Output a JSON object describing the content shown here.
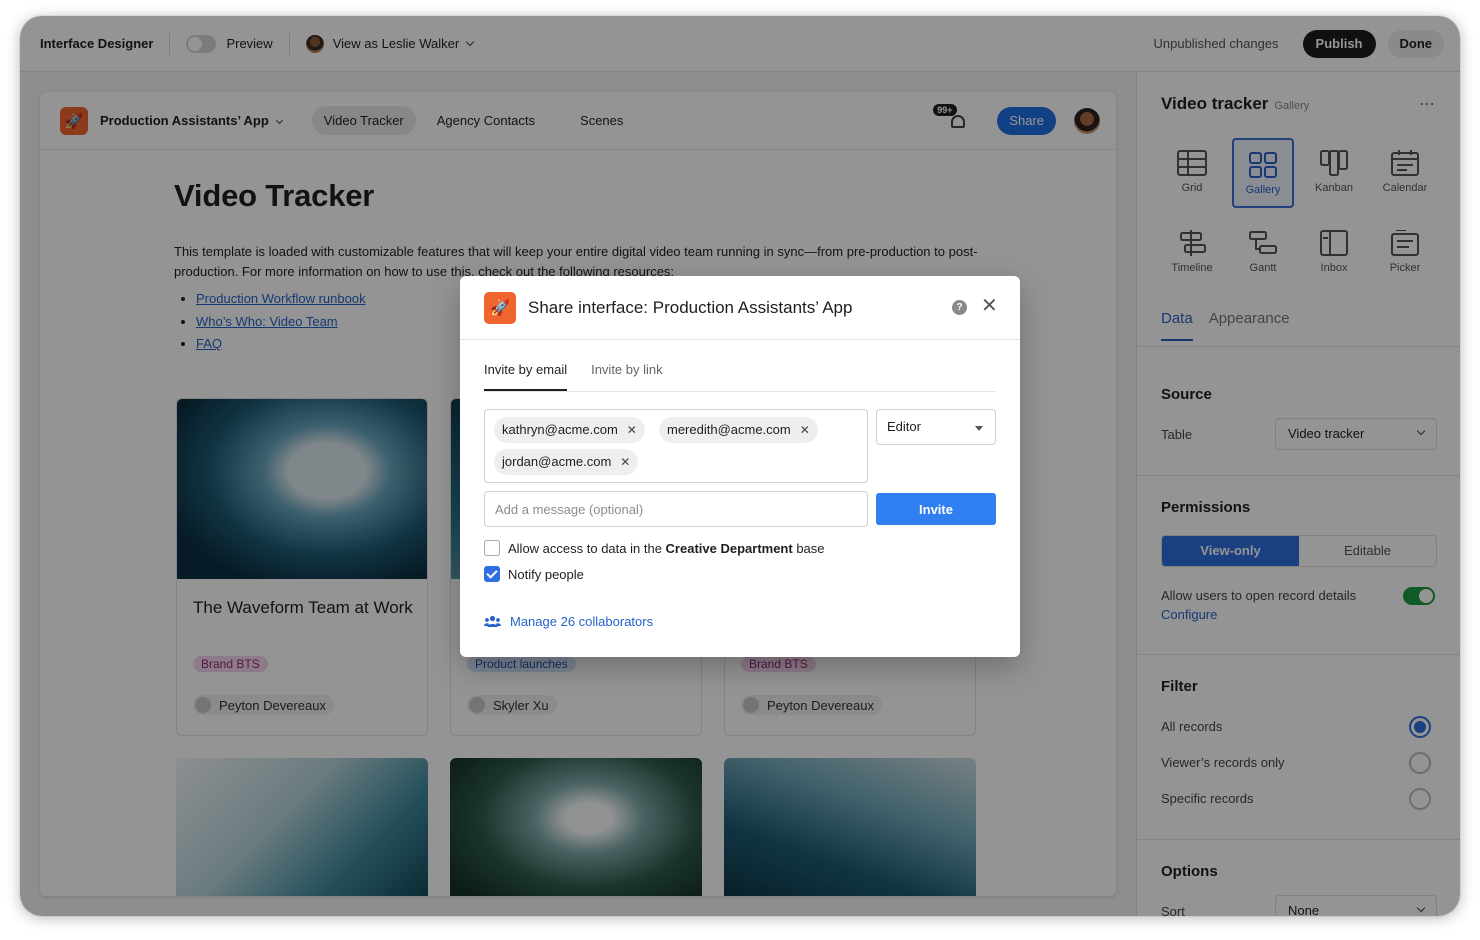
{
  "topbar": {
    "title": "Interface Designer",
    "preview_label": "Preview",
    "view_as_label": "View as",
    "view_as_user": "Leslie Walker",
    "unpublished": "Unpublished changes",
    "publish_label": "Publish",
    "done_label": "Done"
  },
  "app": {
    "name": "Production Assistants’ App",
    "tabs": [
      {
        "label": "Video Tracker",
        "active": true
      },
      {
        "label": "Agency Contacts",
        "active": false
      },
      {
        "label": "Scenes",
        "active": false
      }
    ],
    "notif_count": "99+",
    "share_label": "Share"
  },
  "page": {
    "title": "Video Tracker",
    "description": "This template is loaded with customizable features that will keep your entire digital video team running in sync—from pre-production to post-production. For more information on how to use this, check out the following resources:",
    "links": [
      "Production Workflow runbook",
      "Who’s Who: Video Team",
      "FAQ"
    ]
  },
  "cards": [
    {
      "title": "The Waveform Team at Work",
      "tag": "Brand BTS",
      "person": "Peyton Devereaux"
    },
    {
      "title": "",
      "tag": "Product launches",
      "person": "Skyler Xu"
    },
    {
      "title": "",
      "tag": "Brand BTS",
      "person": "Peyton Devereaux"
    }
  ],
  "panel": {
    "title": "Video tracker",
    "subtitle": "Gallery",
    "views": [
      {
        "label": "Grid",
        "icon": "grid-icon"
      },
      {
        "label": "Gallery",
        "icon": "gallery-icon",
        "active": true
      },
      {
        "label": "Kanban",
        "icon": "kanban-icon"
      },
      {
        "label": "Calendar",
        "icon": "calendar-icon"
      },
      {
        "label": "Timeline",
        "icon": "timeline-icon"
      },
      {
        "label": "Gantt",
        "icon": "gantt-icon"
      },
      {
        "label": "Inbox",
        "icon": "inbox-icon"
      },
      {
        "label": "Picker",
        "icon": "picker-icon"
      }
    ],
    "tabs": {
      "data": "Data",
      "appearance": "Appearance"
    },
    "source": {
      "heading": "Source",
      "table_label": "Table",
      "table_value": "Video tracker"
    },
    "permissions": {
      "heading": "Permissions",
      "view_only": "View-only",
      "editable": "Editable",
      "allow_details": "Allow users to open record details",
      "configure": "Configure"
    },
    "filter": {
      "heading": "Filter",
      "options": [
        "All records",
        "Viewer’s records only",
        "Specific records"
      ],
      "selected": "All records"
    },
    "options": {
      "heading": "Options",
      "sort_label": "Sort",
      "sort_value": "None"
    }
  },
  "modal": {
    "title": "Share interface: Production Assistants’ App",
    "tabs": {
      "email": "Invite by email",
      "link": "Invite by link"
    },
    "emails": [
      "kathryn@acme.com",
      "meredith@acme.com",
      "jordan@acme.com"
    ],
    "role": "Editor",
    "message_placeholder": "Add a message (optional)",
    "invite_label": "Invite",
    "allow_access_prefix": "Allow access to data in the",
    "allow_access_base": "Creative Department",
    "allow_access_suffix": "base",
    "allow_access_checked": false,
    "notify_label": "Notify people",
    "notify_checked": true,
    "manage_label": "Manage 26 collaborators"
  },
  "colors": {
    "accent_blue": "#2f6ee0",
    "brand_orange": "#f0652e",
    "toggle_green": "#1e9c43"
  }
}
